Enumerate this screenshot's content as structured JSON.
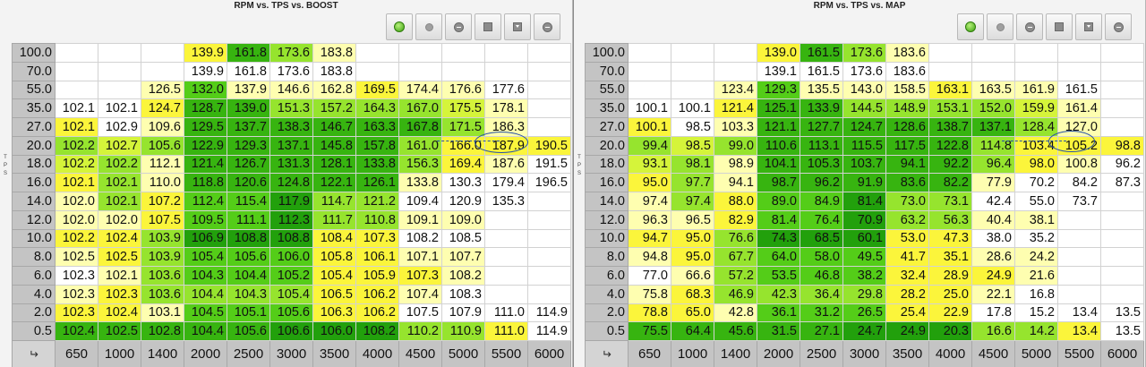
{
  "colors": {
    "white": "#ffffff",
    "pale_yellow": "#fefeb0",
    "yellow": "#fbf53b",
    "yellow_green": "#d5f43a",
    "light_green": "#96e42e",
    "green": "#54cd18",
    "mid_green": "#37b410",
    "dark_green": "#22a00c"
  },
  "boost": {
    "title": "RPM vs. TPS vs. BOOST",
    "axis_letters": "T P S",
    "toolbar": [
      {
        "name": "refresh-icon",
        "icon": "ic-green"
      },
      {
        "name": "record-icon",
        "icon": "ic-gray"
      },
      {
        "name": "minus-circle-icon",
        "icon": "ic-minus"
      },
      {
        "name": "stop-square-icon",
        "icon": "ic-square"
      },
      {
        "name": "download-icon",
        "icon": "ic-down"
      },
      {
        "name": "remove-icon",
        "icon": "ic-minus"
      }
    ],
    "tps_rows": [
      "100.0",
      "70.0",
      "55.0",
      "35.0",
      "27.0",
      "20.0",
      "18.0",
      "16.0",
      "14.0",
      "12.0",
      "10.0",
      "8.0",
      "6.0",
      "4.0",
      "2.0",
      "0.5"
    ],
    "rpm_cols": [
      "650",
      "1000",
      "1400",
      "2000",
      "2500",
      "3000",
      "3500",
      "4000",
      "4500",
      "5000",
      "5500",
      "6000"
    ],
    "corner": "↵",
    "cells": [
      [
        "",
        "",
        "",
        "139.9",
        "161.8",
        "173.6",
        "183.8",
        "",
        "",
        "",
        "",
        ""
      ],
      [
        "",
        "",
        "",
        "139.9",
        "161.8",
        "173.6",
        "183.8",
        "",
        "",
        "",
        "",
        ""
      ],
      [
        "",
        "",
        "126.5",
        "132.0",
        "137.9",
        "146.6",
        "162.8",
        "169.5",
        "174.4",
        "176.6",
        "177.6",
        ""
      ],
      [
        "102.1",
        "102.1",
        "124.7",
        "128.7",
        "139.0",
        "151.3",
        "157.2",
        "164.3",
        "167.0",
        "175.5",
        "178.1",
        ""
      ],
      [
        "102.1",
        "102.9",
        "109.6",
        "129.5",
        "137.7",
        "138.3",
        "146.7",
        "163.3",
        "167.8",
        "171.5",
        "186.3",
        ""
      ],
      [
        "102.2",
        "102.7",
        "105.6",
        "122.9",
        "129.3",
        "137.1",
        "145.8",
        "157.8",
        "161.0",
        "166.0",
        "187.9",
        "190.5"
      ],
      [
        "102.2",
        "102.2",
        "112.1",
        "121.4",
        "126.7",
        "131.3",
        "128.1",
        "133.8",
        "156.3",
        "169.4",
        "187.6",
        "191.5"
      ],
      [
        "102.1",
        "102.1",
        "110.0",
        "118.8",
        "120.6",
        "124.8",
        "122.1",
        "126.1",
        "133.8",
        "130.3",
        "179.4",
        "196.5"
      ],
      [
        "102.0",
        "102.1",
        "107.2",
        "112.4",
        "115.4",
        "117.9",
        "114.7",
        "121.2",
        "109.4",
        "120.9",
        "135.3",
        ""
      ],
      [
        "102.0",
        "102.0",
        "107.5",
        "109.5",
        "111.1",
        "112.3",
        "111.7",
        "110.8",
        "109.1",
        "109.0",
        "",
        ""
      ],
      [
        "102.2",
        "102.4",
        "103.9",
        "106.9",
        "108.8",
        "108.8",
        "108.4",
        "107.3",
        "108.2",
        "108.5",
        "",
        ""
      ],
      [
        "102.5",
        "102.5",
        "103.9",
        "105.4",
        "105.6",
        "106.0",
        "105.8",
        "106.1",
        "107.1",
        "107.7",
        "",
        ""
      ],
      [
        "102.3",
        "102.1",
        "103.6",
        "104.3",
        "104.4",
        "105.2",
        "105.4",
        "105.9",
        "107.3",
        "108.2",
        "",
        ""
      ],
      [
        "102.3",
        "102.3",
        "103.6",
        "104.4",
        "104.3",
        "105.4",
        "106.5",
        "106.2",
        "107.4",
        "108.3",
        "",
        ""
      ],
      [
        "102.3",
        "102.4",
        "103.1",
        "104.5",
        "105.1",
        "105.6",
        "106.3",
        "106.2",
        "107.5",
        "107.9",
        "111.0",
        "114.9"
      ],
      [
        "102.4",
        "102.5",
        "102.8",
        "104.4",
        "105.6",
        "106.6",
        "106.0",
        "108.2",
        "110.2",
        "110.9",
        "111.0",
        "114.9"
      ]
    ],
    "cell_colors": [
      [
        "white",
        "white",
        "white",
        "yellow",
        "mid_green",
        "light_green",
        "pale_yellow",
        "white",
        "white",
        "white",
        "white",
        "white"
      ],
      [
        "white",
        "white",
        "white",
        "white",
        "white",
        "white",
        "white",
        "white",
        "white",
        "white",
        "white",
        "white"
      ],
      [
        "white",
        "white",
        "pale_yellow",
        "green",
        "pale_yellow",
        "pale_yellow",
        "pale_yellow",
        "yellow",
        "pale_yellow",
        "pale_yellow",
        "white",
        "white"
      ],
      [
        "white",
        "white",
        "yellow",
        "mid_green",
        "mid_green",
        "light_green",
        "light_green",
        "light_green",
        "light_green",
        "yellow_green",
        "pale_yellow",
        "white"
      ],
      [
        "yellow",
        "white",
        "pale_yellow",
        "mid_green",
        "mid_green",
        "mid_green",
        "mid_green",
        "mid_green",
        "mid_green",
        "light_green",
        "pale_yellow",
        "white"
      ],
      [
        "light_green",
        "yellow_green",
        "light_green",
        "mid_green",
        "mid_green",
        "mid_green",
        "mid_green",
        "mid_green",
        "light_green",
        "yellow",
        "yellow",
        "yellow"
      ],
      [
        "yellow_green",
        "light_green",
        "pale_yellow",
        "mid_green",
        "mid_green",
        "mid_green",
        "mid_green",
        "mid_green",
        "light_green",
        "yellow",
        "pale_yellow",
        "white"
      ],
      [
        "yellow",
        "light_green",
        "pale_yellow",
        "mid_green",
        "mid_green",
        "mid_green",
        "mid_green",
        "mid_green",
        "pale_yellow",
        "white",
        "white",
        "white"
      ],
      [
        "pale_yellow",
        "light_green",
        "yellow",
        "green",
        "green",
        "dark_green",
        "light_green",
        "light_green",
        "white",
        "white",
        "white",
        "white"
      ],
      [
        "pale_yellow",
        "pale_yellow",
        "yellow",
        "green",
        "green",
        "dark_green",
        "light_green",
        "light_green",
        "pale_yellow",
        "pale_yellow",
        "white",
        "white"
      ],
      [
        "yellow",
        "yellow",
        "light_green",
        "dark_green",
        "dark_green",
        "dark_green",
        "yellow",
        "yellow",
        "white",
        "white",
        "white",
        "white"
      ],
      [
        "pale_yellow",
        "yellow",
        "light_green",
        "green",
        "green",
        "green",
        "yellow",
        "yellow",
        "pale_yellow",
        "pale_yellow",
        "white",
        "white"
      ],
      [
        "white",
        "pale_yellow",
        "light_green",
        "green",
        "green",
        "green",
        "yellow",
        "yellow",
        "yellow",
        "pale_yellow",
        "white",
        "white"
      ],
      [
        "pale_yellow",
        "yellow",
        "light_green",
        "light_green",
        "light_green",
        "light_green",
        "yellow",
        "yellow",
        "pale_yellow",
        "white",
        "white",
        "white"
      ],
      [
        "yellow",
        "yellow",
        "pale_yellow",
        "green",
        "green",
        "green",
        "yellow",
        "yellow",
        "white",
        "white",
        "white",
        "white"
      ],
      [
        "mid_green",
        "mid_green",
        "mid_green",
        "mid_green",
        "mid_green",
        "dark_green",
        "dark_green",
        "dark_green",
        "light_green",
        "light_green",
        "yellow",
        "white"
      ]
    ]
  },
  "map": {
    "title": "RPM vs. TPS vs. MAP",
    "axis_letters": "T P S",
    "toolbar": [
      {
        "name": "refresh-icon",
        "icon": "ic-green"
      },
      {
        "name": "record-icon",
        "icon": "ic-gray"
      },
      {
        "name": "minus-circle-icon",
        "icon": "ic-minus"
      },
      {
        "name": "stop-square-icon",
        "icon": "ic-square"
      },
      {
        "name": "download-icon",
        "icon": "ic-down"
      },
      {
        "name": "remove-icon",
        "icon": "ic-minus"
      }
    ],
    "tps_rows": [
      "100.0",
      "70.0",
      "55.0",
      "35.0",
      "27.0",
      "20.0",
      "18.0",
      "16.0",
      "14.0",
      "12.0",
      "10.0",
      "8.0",
      "6.0",
      "4.0",
      "2.0",
      "0.5"
    ],
    "rpm_cols": [
      "650",
      "1000",
      "1400",
      "2000",
      "2500",
      "3000",
      "3500",
      "4000",
      "4500",
      "5000",
      "5500",
      "6000"
    ],
    "corner": "↵",
    "cells": [
      [
        "",
        "",
        "",
        "139.0",
        "161.5",
        "173.6",
        "183.6",
        "",
        "",
        "",
        "",
        ""
      ],
      [
        "",
        "",
        "",
        "139.1",
        "161.5",
        "173.6",
        "183.6",
        "",
        "",
        "",
        "",
        ""
      ],
      [
        "",
        "",
        "123.4",
        "129.3",
        "135.5",
        "143.0",
        "158.5",
        "163.1",
        "163.5",
        "161.9",
        "161.5",
        ""
      ],
      [
        "100.1",
        "100.1",
        "121.4",
        "125.1",
        "133.9",
        "144.5",
        "148.9",
        "153.1",
        "152.0",
        "159.9",
        "161.4",
        ""
      ],
      [
        "100.1",
        "98.5",
        "103.3",
        "121.1",
        "127.7",
        "124.7",
        "128.6",
        "138.7",
        "137.1",
        "128.4",
        "127.0",
        ""
      ],
      [
        "99.4",
        "98.5",
        "99.0",
        "110.6",
        "113.1",
        "115.5",
        "117.5",
        "122.8",
        "114.8",
        "103.4",
        "105.2",
        "98.8"
      ],
      [
        "93.1",
        "98.1",
        "98.9",
        "104.1",
        "105.3",
        "103.7",
        "94.1",
        "92.2",
        "96.4",
        "98.0",
        "100.8",
        "96.2"
      ],
      [
        "95.0",
        "97.7",
        "94.1",
        "98.7",
        "96.2",
        "91.9",
        "83.6",
        "82.2",
        "77.9",
        "70.2",
        "84.2",
        "87.3"
      ],
      [
        "97.4",
        "97.4",
        "88.0",
        "89.0",
        "84.9",
        "81.4",
        "73.0",
        "73.1",
        "42.4",
        "55.0",
        "73.7",
        ""
      ],
      [
        "96.3",
        "96.5",
        "82.9",
        "81.4",
        "76.4",
        "70.9",
        "63.2",
        "56.3",
        "40.4",
        "38.1",
        "",
        ""
      ],
      [
        "94.7",
        "95.0",
        "76.6",
        "74.3",
        "68.5",
        "60.1",
        "53.0",
        "47.3",
        "38.0",
        "35.2",
        "",
        ""
      ],
      [
        "94.8",
        "95.0",
        "67.7",
        "64.0",
        "58.0",
        "49.5",
        "41.7",
        "35.1",
        "28.6",
        "24.2",
        "",
        ""
      ],
      [
        "77.0",
        "66.6",
        "57.2",
        "53.5",
        "46.8",
        "38.2",
        "32.4",
        "28.9",
        "24.9",
        "21.6",
        "",
        ""
      ],
      [
        "75.8",
        "68.3",
        "46.9",
        "42.3",
        "36.4",
        "29.8",
        "28.2",
        "25.0",
        "22.1",
        "16.8",
        "",
        ""
      ],
      [
        "78.8",
        "65.0",
        "42.8",
        "36.1",
        "31.2",
        "26.5",
        "25.4",
        "22.9",
        "17.8",
        "15.2",
        "13.4",
        "13.5"
      ],
      [
        "75.5",
        "64.4",
        "45.6",
        "31.5",
        "27.1",
        "24.7",
        "24.9",
        "20.3",
        "16.6",
        "14.2",
        "13.4",
        "13.5"
      ]
    ],
    "cell_colors": [
      [
        "white",
        "white",
        "white",
        "yellow",
        "mid_green",
        "light_green",
        "pale_yellow",
        "white",
        "white",
        "white",
        "white",
        "white"
      ],
      [
        "white",
        "white",
        "white",
        "white",
        "white",
        "white",
        "white",
        "white",
        "white",
        "white",
        "white",
        "white"
      ],
      [
        "white",
        "white",
        "pale_yellow",
        "green",
        "pale_yellow",
        "pale_yellow",
        "pale_yellow",
        "yellow",
        "pale_yellow",
        "pale_yellow",
        "white",
        "white"
      ],
      [
        "white",
        "white",
        "yellow",
        "mid_green",
        "mid_green",
        "light_green",
        "light_green",
        "light_green",
        "light_green",
        "yellow_green",
        "pale_yellow",
        "white"
      ],
      [
        "yellow",
        "white",
        "pale_yellow",
        "mid_green",
        "mid_green",
        "mid_green",
        "mid_green",
        "mid_green",
        "mid_green",
        "light_green",
        "pale_yellow",
        "white"
      ],
      [
        "light_green",
        "yellow_green",
        "light_green",
        "mid_green",
        "mid_green",
        "mid_green",
        "mid_green",
        "mid_green",
        "light_green",
        "yellow",
        "yellow",
        "yellow"
      ],
      [
        "yellow_green",
        "light_green",
        "pale_yellow",
        "mid_green",
        "mid_green",
        "mid_green",
        "mid_green",
        "mid_green",
        "light_green",
        "yellow",
        "pale_yellow",
        "white"
      ],
      [
        "yellow",
        "light_green",
        "pale_yellow",
        "mid_green",
        "mid_green",
        "mid_green",
        "mid_green",
        "mid_green",
        "pale_yellow",
        "white",
        "white",
        "white"
      ],
      [
        "pale_yellow",
        "light_green",
        "yellow",
        "green",
        "green",
        "dark_green",
        "light_green",
        "light_green",
        "white",
        "white",
        "white",
        "white"
      ],
      [
        "pale_yellow",
        "pale_yellow",
        "yellow",
        "green",
        "green",
        "dark_green",
        "light_green",
        "light_green",
        "pale_yellow",
        "pale_yellow",
        "white",
        "white"
      ],
      [
        "yellow",
        "yellow",
        "light_green",
        "dark_green",
        "dark_green",
        "dark_green",
        "yellow",
        "yellow",
        "white",
        "white",
        "white",
        "white"
      ],
      [
        "pale_yellow",
        "yellow",
        "light_green",
        "green",
        "green",
        "green",
        "yellow",
        "yellow",
        "pale_yellow",
        "pale_yellow",
        "white",
        "white"
      ],
      [
        "white",
        "pale_yellow",
        "light_green",
        "green",
        "green",
        "green",
        "yellow",
        "yellow",
        "yellow",
        "pale_yellow",
        "white",
        "white"
      ],
      [
        "pale_yellow",
        "yellow",
        "light_green",
        "light_green",
        "light_green",
        "light_green",
        "yellow",
        "yellow",
        "pale_yellow",
        "white",
        "white",
        "white"
      ],
      [
        "yellow",
        "yellow",
        "pale_yellow",
        "green",
        "green",
        "green",
        "yellow",
        "yellow",
        "white",
        "white",
        "white",
        "white"
      ],
      [
        "mid_green",
        "mid_green",
        "mid_green",
        "mid_green",
        "mid_green",
        "dark_green",
        "dark_green",
        "dark_green",
        "light_green",
        "light_green",
        "yellow",
        "white"
      ]
    ]
  }
}
